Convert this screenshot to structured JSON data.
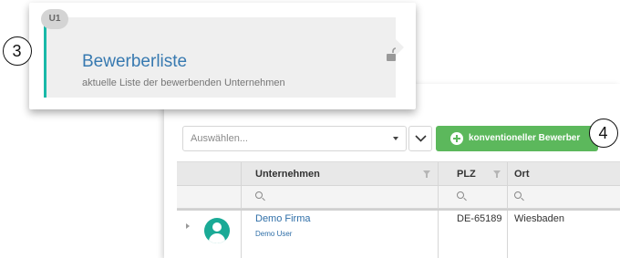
{
  "card": {
    "badge": "U1",
    "title": "Bewerberliste",
    "subtitle": "aktuelle Liste der bewerbenden Unternehmen",
    "icon": "unlocked-padlock-icon"
  },
  "callouts": {
    "left": "3",
    "right": "4"
  },
  "toolbar": {
    "select_placeholder": "Auswählen...",
    "add_button_label": "konventioneller Bewerber",
    "accent_color": "#5cb85c"
  },
  "grid": {
    "columns": [
      "Unternehmen",
      "PLZ",
      "Ort"
    ],
    "rows": [
      {
        "company": "Demo Firma",
        "user": "Demo User",
        "plz": "DE-65189",
        "ort": "Wiesbaden"
      }
    ]
  },
  "colors": {
    "card_accent": "#19b9a8",
    "title": "#3779b0",
    "link": "#2f6fa8"
  }
}
